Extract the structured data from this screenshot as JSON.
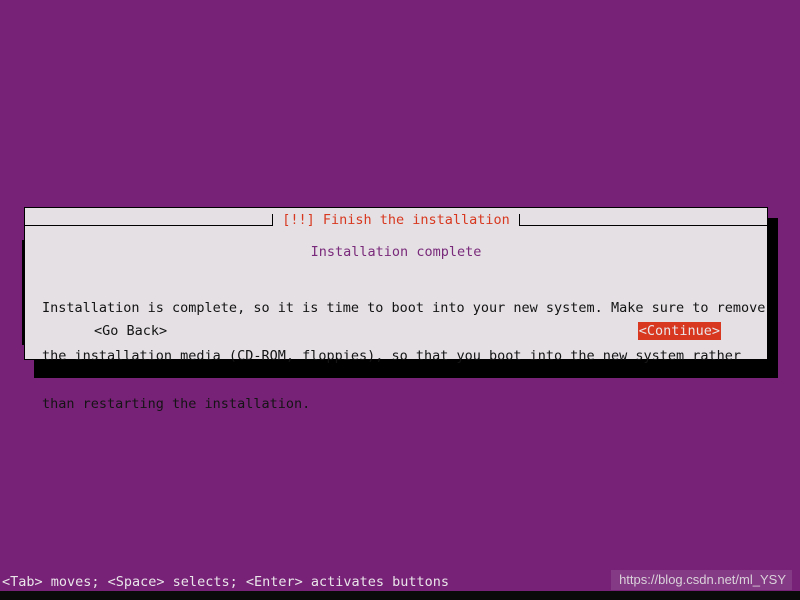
{
  "screen": {
    "background_color": "#772277",
    "dialog_background_color": "#e4e0e4",
    "accent_red": "#d8381f",
    "heading_purple": "#7a2a7a"
  },
  "dialog": {
    "title": "[!!] Finish the installation",
    "heading": "Installation complete",
    "body_lines": [
      "Installation is complete, so it is time to boot into your new system. Make sure to remove",
      "the installation media (CD-ROM, floppies), so that you boot into the new system rather",
      "than restarting the installation."
    ],
    "buttons": {
      "go_back": "<Go Back>",
      "continue": "<Continue>"
    }
  },
  "status_bar": {
    "hint": "<Tab> moves; <Space> selects; <Enter> activates buttons"
  },
  "watermark": {
    "text": "https://blog.csdn.net/ml_YSY"
  }
}
